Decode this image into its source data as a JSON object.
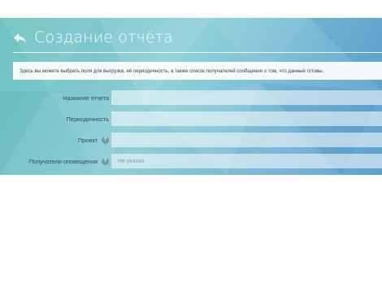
{
  "header": {
    "title": "Создание отчёта",
    "back_icon": "back-arrow-icon"
  },
  "info": {
    "text": "Здесь вы можете выбрать поля для выгрузки, её периодичность, а также список получателей сообщения о том, что данные готовы."
  },
  "form": {
    "report_name": {
      "label": "Название отчета",
      "value": ""
    },
    "periodicity": {
      "label": "Периодичность",
      "value": ""
    },
    "project": {
      "label": "Проект",
      "value": "",
      "help_icon": "help-icon"
    },
    "recipients": {
      "label": "Получатели оповещения",
      "placeholder": "Не указан",
      "help_icon": "help-icon"
    }
  },
  "colors": {
    "panel_start": "#6ec3c0",
    "panel_end": "#5e9fd0",
    "label_text": "#34495a"
  }
}
